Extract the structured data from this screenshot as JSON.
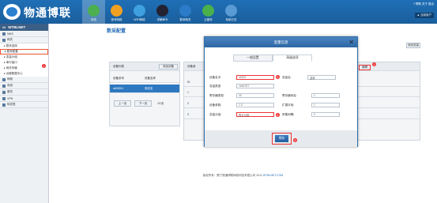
{
  "header": {
    "brand": "物通博联",
    "nav": [
      {
        "label": "状态",
        "icon": "home-icon",
        "active": true
      },
      {
        "label": "信号网络",
        "icon": "signal-icon"
      },
      {
        "label": "WIFI网络",
        "icon": "wifi-icon"
      },
      {
        "label": "详解命令",
        "icon": "command-icon"
      },
      {
        "label": "数采网关",
        "icon": "gateway-icon"
      },
      {
        "label": "云服务",
        "icon": "cloud-icon"
      },
      {
        "label": "系统日志",
        "icon": "log-icon"
      }
    ],
    "topright": "? 帮助  关于  退出",
    "user": "▲ 当前用户"
  },
  "sidebar": {
    "title": "WTBLNET",
    "items": [
      {
        "label": "NMS",
        "type": "group"
      },
      {
        "label": "网关",
        "type": "group"
      },
      {
        "label": "▸ 数采选择",
        "type": "sub"
      },
      {
        "label": "▸ 数采配置",
        "type": "sub",
        "selected": true
      },
      {
        "label": "▸ 变量分组",
        "type": "sub"
      },
      {
        "label": "▸ 串行接口",
        "type": "sub"
      },
      {
        "label": "▸ 网关传输",
        "type": "sub"
      },
      {
        "label": "▸ 远程数据中心",
        "type": "sub"
      },
      {
        "label": "网络",
        "type": "group"
      },
      {
        "label": "系统",
        "type": "group"
      },
      {
        "label": "服务",
        "type": "group"
      },
      {
        "label": "VPN",
        "type": "group"
      },
      {
        "label": "转发表",
        "type": "group"
      }
    ]
  },
  "main": {
    "title": "数采配置",
    "left_panel": {
      "header": "设备列表",
      "add_btn": "添加设备",
      "columns": [
        "设备序号",
        "设备名称"
      ],
      "rows": [
        [
          "wt00001",
          "测试名"
        ]
      ],
      "pager": [
        "上一页",
        "下一页",
        "1/1页"
      ]
    },
    "right_panel": {
      "header": "设备参",
      "col": "ID",
      "rows": [
        "1",
        "2",
        "3"
      ],
      "edit_btn": "编辑",
      "add_btn": "添加变量"
    }
  },
  "modal": {
    "title": "变量信息",
    "tabs": [
      "一般设置",
      "高级选项"
    ],
    "fields": [
      {
        "label": "设备名字:",
        "value": "40001"
      },
      {
        "label": "变量类型:",
        "value": "16HOST"
      },
      {
        "label": "寄存器类型:",
        "value": "40"
      },
      {
        "label": "设备参数:",
        "value": "1.0"
      },
      {
        "label": "变量分组:",
        "value": "默认分组"
      }
    ],
    "fields_right": [
      {
        "label": "变量名:",
        "value": "温度"
      },
      {
        "label": "寄存器地址:",
        "value": "1"
      },
      {
        "label": "扩展字段:",
        "value": "1"
      },
      {
        "label": "采集间隔:",
        "value": "0"
      }
    ],
    "save": "保存",
    "markers": [
      "1",
      "2",
      "3",
      "4",
      "5",
      "6"
    ]
  },
  "footer": {
    "text": "版权所有：厦门物通博联网络科技有限公司  2011  ",
    "link": "WTBLNET.COM"
  }
}
